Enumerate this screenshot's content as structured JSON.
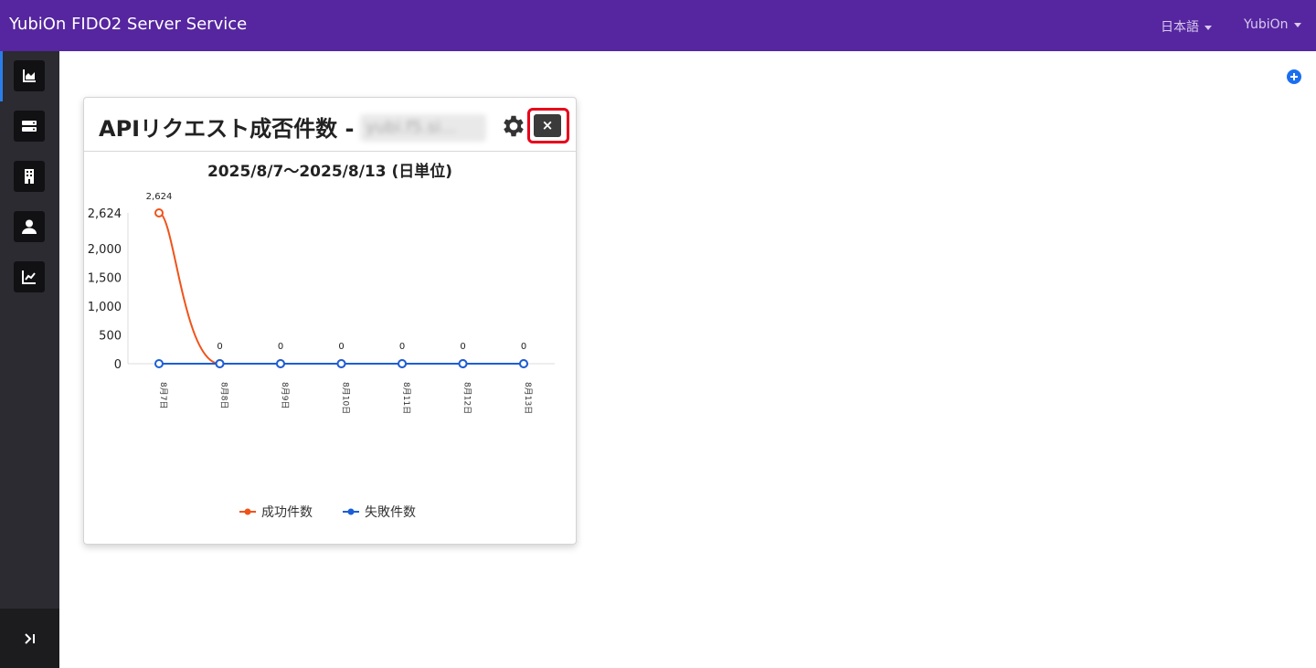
{
  "header": {
    "brand": "YubiOn FIDO2 Server Service",
    "language": "日本語",
    "user": "YubiOn"
  },
  "sidebar": {
    "items": [
      {
        "icon": "area-chart-icon",
        "active": true
      },
      {
        "icon": "server-icon",
        "active": false
      },
      {
        "icon": "building-icon",
        "active": false
      },
      {
        "icon": "user-icon",
        "active": false
      },
      {
        "icon": "line-chart-icon",
        "active": false
      }
    ],
    "toggle_icon": "expand-sidebar-icon"
  },
  "widget": {
    "title": "APIリクエスト成否件数 - ",
    "blurred_name": "yubi.f5.si...",
    "gear_icon": "gear-icon",
    "close_label": "×"
  },
  "chart_data": {
    "type": "line",
    "title": "2025/8/7〜2025/8/13 (日単位)",
    "categories": [
      "8月7日",
      "8月8日",
      "8月9日",
      "8月10日",
      "8月11日",
      "8月12日",
      "8月13日"
    ],
    "series": [
      {
        "name": "成功件数",
        "color": "#f0531a",
        "values": [
          2624,
          0,
          0,
          0,
          0,
          0,
          0
        ]
      },
      {
        "name": "失敗件数",
        "color": "#1a5fd8",
        "values": [
          0,
          0,
          0,
          0,
          0,
          0,
          0
        ]
      }
    ],
    "yticks": [
      "0",
      "500",
      "1,000",
      "1,500",
      "2,000",
      "2,624"
    ],
    "ytick_values": [
      0,
      500,
      1000,
      1500,
      2000,
      2624
    ],
    "ylim": [
      0,
      2624
    ],
    "data_labels": {
      "success": [
        "2,624",
        "0",
        "0",
        "0",
        "0",
        "0",
        "0"
      ],
      "failure": [
        "0",
        "0",
        "0",
        "0",
        "0",
        "0",
        "0"
      ]
    },
    "legend_position": "bottom"
  }
}
